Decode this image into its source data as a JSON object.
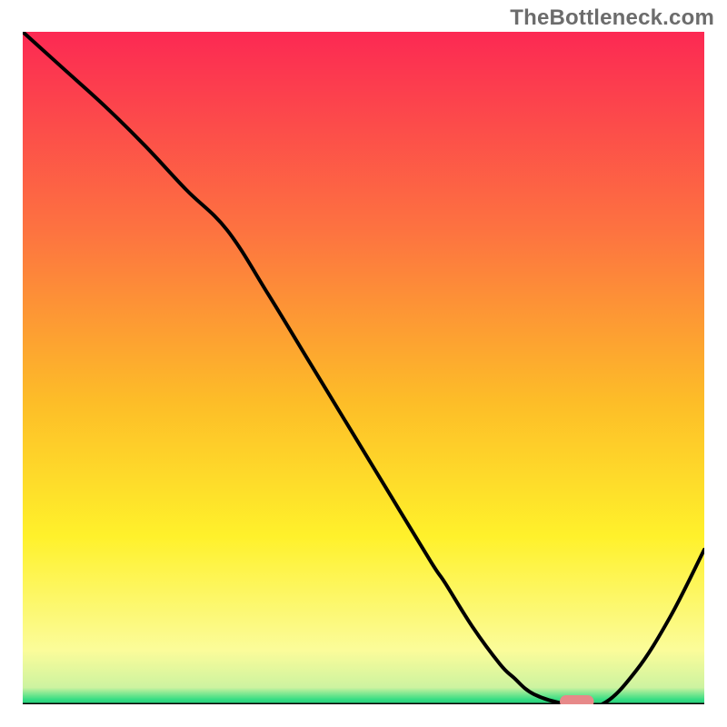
{
  "watermark": "TheBottleneck.com",
  "chart_data": {
    "type": "line",
    "title": "",
    "xlabel": "",
    "ylabel": "",
    "xlim": [
      0,
      100
    ],
    "ylim": [
      0,
      100
    ],
    "grid": false,
    "legend": false,
    "series": [
      {
        "name": "curve",
        "x": [
          0,
          6,
          12,
          18,
          24,
          30,
          36,
          42,
          48,
          54,
          60,
          62,
          66,
          70,
          72,
          75,
          80,
          85,
          90,
          95,
          100
        ],
        "y": [
          100,
          94.5,
          89,
          83,
          76.5,
          70.5,
          61,
          51,
          41,
          31,
          21,
          18,
          11.5,
          6,
          4,
          1.5,
          0,
          0,
          5,
          13,
          23
        ],
        "color": "#000000"
      }
    ],
    "marker": {
      "name": "optimal-marker",
      "x_center": 81.3,
      "y_center": 0,
      "width": 5,
      "color": "#e78989"
    },
    "background_gradient": {
      "stops": [
        {
          "offset": 0,
          "color": "#fc2953"
        },
        {
          "offset": 30,
          "color": "#fd7440"
        },
        {
          "offset": 55,
          "color": "#fdbd28"
        },
        {
          "offset": 75,
          "color": "#fff12b"
        },
        {
          "offset": 92,
          "color": "#fbfc9a"
        },
        {
          "offset": 97.5,
          "color": "#cdf3a0"
        },
        {
          "offset": 99.3,
          "color": "#35dd83"
        },
        {
          "offset": 100,
          "color": "#25c977"
        }
      ]
    },
    "axis_line_color": "#000000"
  }
}
